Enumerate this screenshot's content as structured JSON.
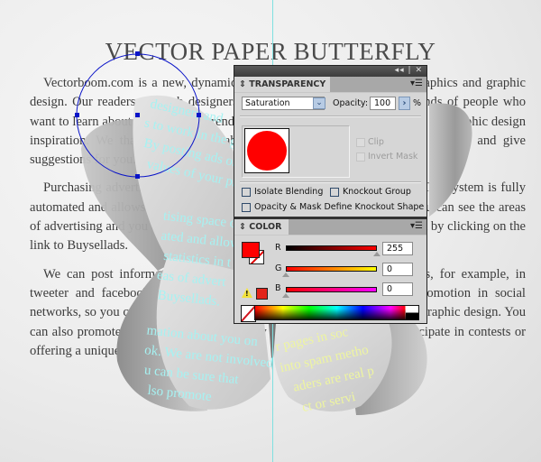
{
  "document": {
    "title": "VECTOR PAPER BUTTERFLY",
    "paragraphs": [
      "Vectorboom.com is a new, dynamic and growing blog about vector graphics and graphic design. Our readers are web designers and graphic designers and thousands of people who want to learn about the news and trends in graphic design and want to look for graphic design inspiration. We thank our readers about them and the values of your product and give suggestions for you.",
      "Purchasing advertising space on our site will not take you much time. The system is fully automated and allows you to see statistics in the advertising campaign. You can see the areas of advertising and you can learn more about your options for advertisement by clicking on the link to Buysellads.",
      "We can post information about you on our pages in social networks, for example, in tweeter and facebook. We are not involved into spam methods of promotion in social networks, so you can be sure that our readers are real people interested in graphic design. You can also promote your product or service by offering our readers to participate in contests or offering a unique discount on your product."
    ],
    "wing_text_left": [
      "designers and",
      "s to work in the globe",
      "By posting ads on",
      "values of your pr",
      "tising space on",
      "ated and allow",
      "statistics in t",
      "eas of advert",
      "Buysellads.",
      "mation about you on",
      "ok. We are not involved",
      "u can be sure that",
      "lso promote"
    ],
    "wing_text_right": [
      "r pages in soc",
      "into spam metho",
      "aders are real p",
      "ct or servi"
    ]
  },
  "transparency_panel": {
    "tab_label": "TRANSPARENCY",
    "collapse_icon": "double-arrow-left",
    "close_icon": "x",
    "blend_mode": "Saturation",
    "opacity_label": "Opacity:",
    "opacity_value": "100",
    "percent_label": "%",
    "clip_label": "Clip",
    "invert_mask_label": "Invert Mask",
    "isolate_blending_label": "Isolate Blending",
    "knockout_group_label": "Knockout Group",
    "opacity_mask_label": "Opacity & Mask Define Knockout Shape",
    "thumbnail_color": "#ff0000"
  },
  "color_panel": {
    "tab_label": "COLOR",
    "fill_color": "#ff0000",
    "channels": [
      {
        "label": "R",
        "value": "255",
        "fraction": 1.0
      },
      {
        "label": "G",
        "value": "0",
        "fraction": 0.0
      },
      {
        "label": "B",
        "value": "0",
        "fraction": 0.0
      }
    ],
    "gamut_color": "#e2231a"
  },
  "colors": {
    "guide": "#7fe0e0",
    "selection": "#0a14c8",
    "wing_text_left": "#a6f2f2",
    "wing_text_right": "#eef5a0"
  }
}
